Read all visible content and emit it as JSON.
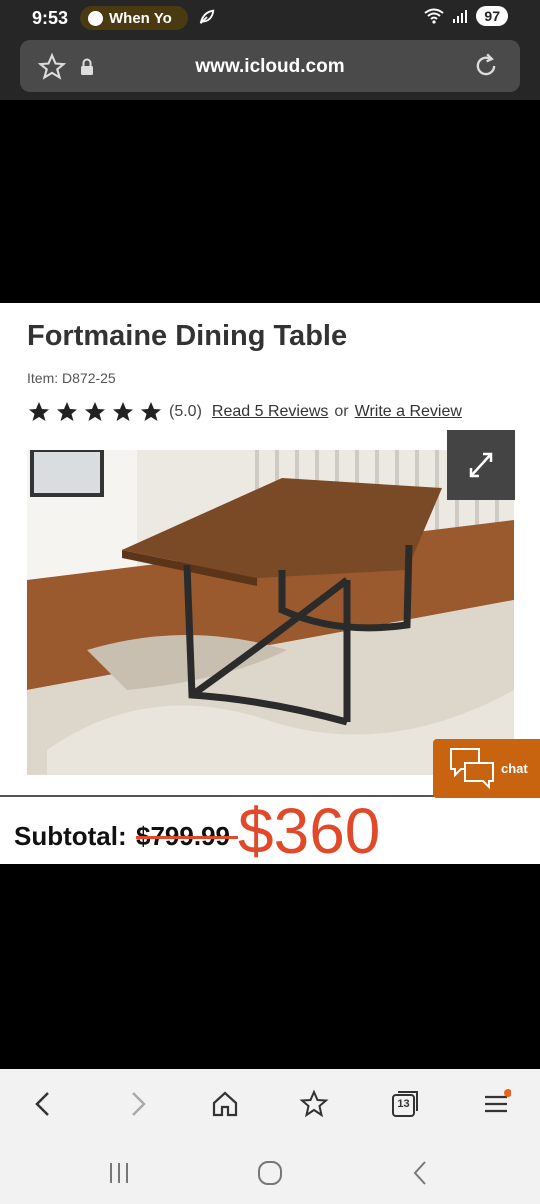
{
  "status_bar": {
    "time": "9:53",
    "media_label": "When Yo",
    "battery": "97"
  },
  "browser": {
    "url": "www.icloud.com"
  },
  "product": {
    "title": "Fortmaine Dining Table",
    "item": "Item: D872-25",
    "rating_stars": 5,
    "rating_text": "(5.0)",
    "read_reviews": "Read 5 Reviews",
    "or": "or",
    "write_review": "Write a Review"
  },
  "pricing": {
    "subtotal_label": "Subtotal:",
    "old_price": "$799.99",
    "new_price": "$360"
  },
  "chat": {
    "label": "chat"
  },
  "bottom_nav": {
    "tabs_count": "13"
  },
  "colors": {
    "accent_red": "#e04a2a",
    "chat_orange": "#c8640f"
  }
}
